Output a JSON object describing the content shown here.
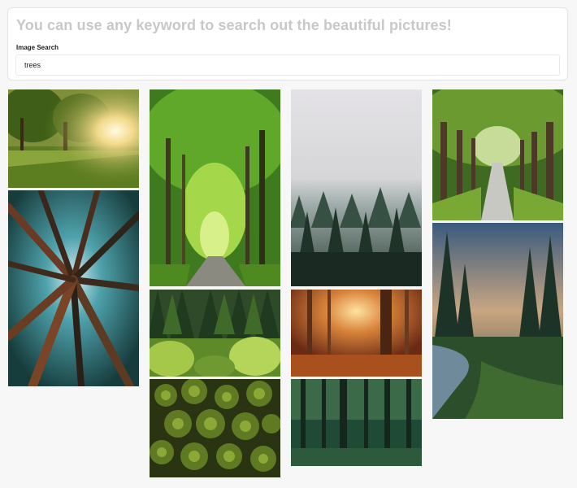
{
  "header": {
    "headline": "You can use any keyword to search out the beautiful pictures!"
  },
  "search": {
    "label": "Image Search",
    "value": "trees"
  },
  "gallery": {
    "images": [
      {
        "subject": "sunlit park trees"
      },
      {
        "subject": "upward view of tall tree trunks"
      },
      {
        "subject": "green tree tunnel road"
      },
      {
        "subject": "pine forest with bushes"
      },
      {
        "subject": "aerial view of green tree tops"
      },
      {
        "subject": "misty pine forest"
      },
      {
        "subject": "autumn forest with sunlight"
      },
      {
        "subject": "dark green forest trunks"
      },
      {
        "subject": "tree lined path"
      },
      {
        "subject": "river through pine forest at dusk"
      }
    ]
  }
}
